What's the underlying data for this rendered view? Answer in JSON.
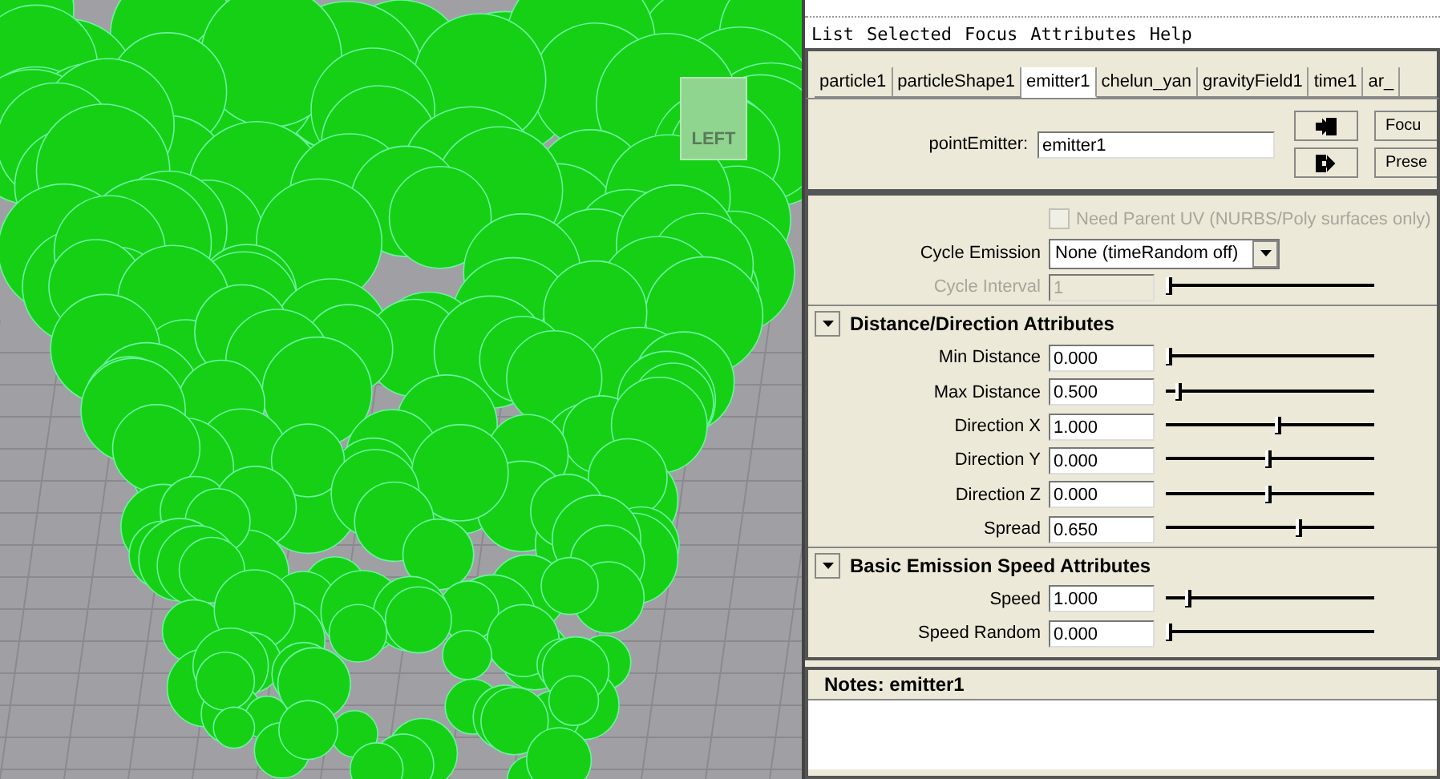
{
  "viewport": {
    "view_cube_label": "LEFT"
  },
  "menu": [
    "List",
    "Selected",
    "Focus",
    "Attributes",
    "Help"
  ],
  "tabs": [
    {
      "label": "particle1",
      "selected": false
    },
    {
      "label": "particleShape1",
      "selected": false
    },
    {
      "label": "emitter1",
      "selected": true
    },
    {
      "label": "chelun_yan",
      "selected": false
    },
    {
      "label": "gravityField1",
      "selected": false
    },
    {
      "label": "time1",
      "selected": false
    },
    {
      "label": "ar_",
      "selected": false
    }
  ],
  "node": {
    "label": "pointEmitter:",
    "value": "emitter1",
    "buttons": [
      "Focu",
      "Prese"
    ]
  },
  "rows": [
    {
      "kind": "checkbox",
      "label": "Need Parent UV (NURBS/Poly surfaces only)",
      "checked": false,
      "disabled": true
    },
    {
      "kind": "dropdown",
      "label": "Cycle Emission",
      "value": "None (timeRandom off)"
    },
    {
      "kind": "slider",
      "label": "Cycle Interval",
      "value": "1",
      "level": 0,
      "disabled": true
    },
    {
      "kind": "section",
      "label": "Distance/Direction Attributes",
      "expanded": true
    },
    {
      "kind": "slider",
      "label": "Min Distance",
      "value": "0.000",
      "level": 0,
      "disabled": false
    },
    {
      "kind": "slider",
      "label": "Max Distance",
      "value": "0.500",
      "level": 0.05,
      "disabled": false
    },
    {
      "kind": "slider",
      "label": "Direction X",
      "value": "1.000",
      "level": 0.55,
      "disabled": false
    },
    {
      "kind": "slider",
      "label": "Direction Y",
      "value": "0.000",
      "level": 0.5,
      "disabled": false
    },
    {
      "kind": "slider",
      "label": "Direction Z",
      "value": "0.000",
      "level": 0.5,
      "disabled": false
    },
    {
      "kind": "slider",
      "label": "Spread",
      "value": "0.650",
      "level": 0.65,
      "disabled": false
    },
    {
      "kind": "section",
      "label": "Basic Emission Speed Attributes",
      "expanded": true
    },
    {
      "kind": "slider",
      "label": "Speed",
      "value": "1.000",
      "level": 0.1,
      "disabled": false
    },
    {
      "kind": "slider",
      "label": "Speed Random",
      "value": "0.000",
      "level": 0,
      "disabled": false
    }
  ],
  "notes": {
    "title": "Notes:  emitter1"
  }
}
